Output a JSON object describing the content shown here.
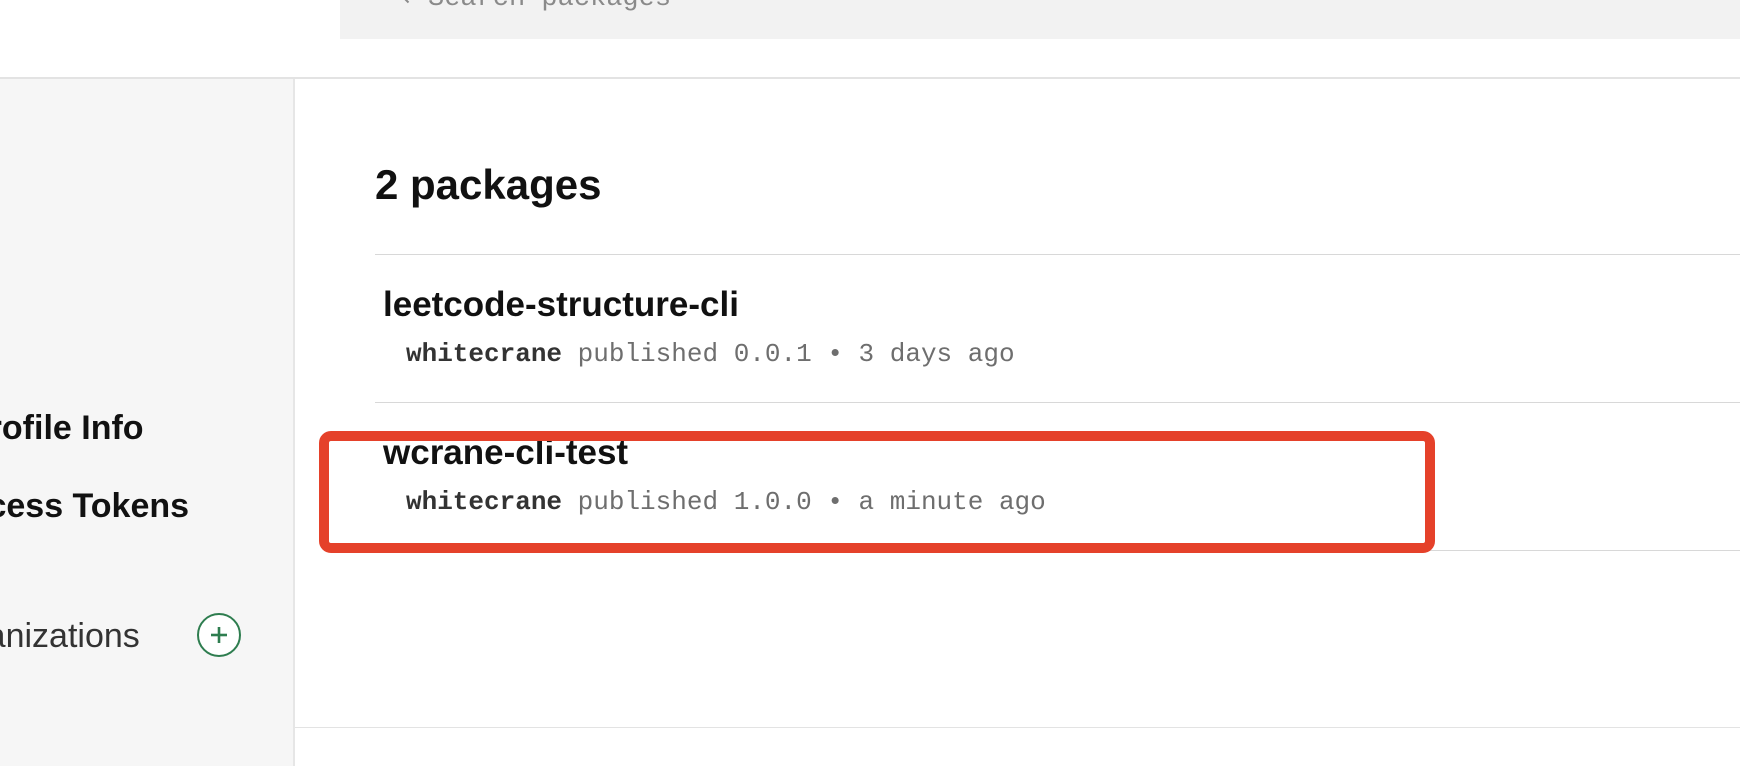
{
  "header": {
    "search": {
      "placeholder": "Search packages"
    }
  },
  "sidebar": {
    "items": [
      {
        "label": "Profile Info"
      },
      {
        "label": "Access Tokens"
      },
      {
        "label": "Organizations"
      }
    ],
    "add_icon": "plus-circle-icon"
  },
  "main": {
    "title": "2 packages",
    "packages": [
      {
        "name": "leetcode-structure-cli",
        "publisher": "whitecrane",
        "published_text": "published",
        "version": "0.0.1",
        "separator": "•",
        "time": "3 days ago"
      },
      {
        "name": "wcrane-cli-test",
        "publisher": "whitecrane",
        "published_text": "published",
        "version": "1.0.0",
        "separator": "•",
        "time": "a minute ago"
      }
    ]
  },
  "colors": {
    "highlight": "#e5412a",
    "accent_green": "#2e7d4f",
    "sidebar_bg": "#f6f6f6"
  }
}
